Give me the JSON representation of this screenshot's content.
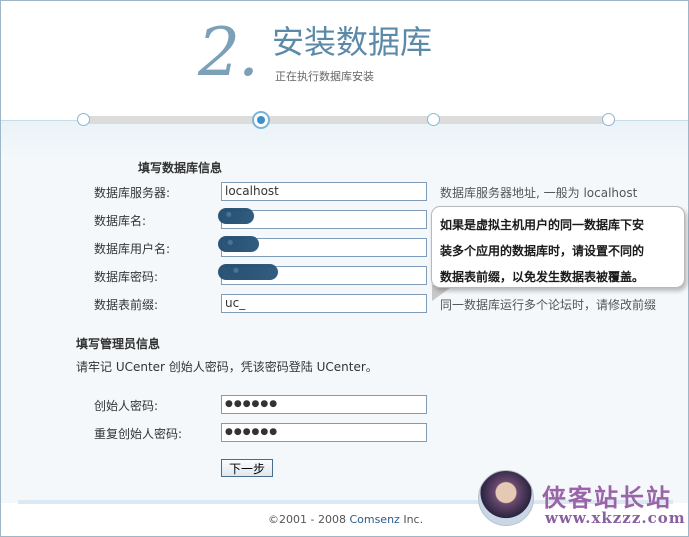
{
  "header": {
    "step_number": "2.",
    "title": "安装数据库",
    "subtitle": "正在执行数据库安装"
  },
  "progress": {
    "total_steps": 4,
    "current_step": 2
  },
  "db_section": {
    "title": "填写数据库信息",
    "fields": [
      {
        "label": "数据库服务器:",
        "value": "localhost",
        "hint": "数据库服务器地址, 一般为 localhost"
      },
      {
        "label": "数据库名:",
        "value": ""
      },
      {
        "label": "数据库用户名:",
        "value": ""
      },
      {
        "label": "数据库密码:",
        "value": ""
      },
      {
        "label": "数据表前缀:",
        "value": "uc_",
        "hint": "同一数据库运行多个论坛时，请修改前缀"
      }
    ]
  },
  "admin_section": {
    "title": "填写管理员信息",
    "note": "请牢记 UCenter 创始人密码，凭该密码登陆 UCenter。",
    "fields": [
      {
        "label": "创始人密码:",
        "value": "●●●●●●"
      },
      {
        "label": "重复创始人密码:",
        "value": "●●●●●●"
      }
    ]
  },
  "buttons": {
    "next": "下一步"
  },
  "tooltip": {
    "lines": [
      "如果是虚拟主机用户的同一数据库下安",
      "装多个应用的数据库时，请设置不同的",
      "数据表前缀，以免发生数据表被覆盖。"
    ]
  },
  "footer": {
    "copyright_prefix": "©2001 - 2008 ",
    "brand": "Comsenz",
    "suffix": " Inc."
  },
  "watermark": {
    "line1": "侠客站长站",
    "line2": "www.xkzzz.com"
  },
  "colors": {
    "accent": "#5b8aa8",
    "active_step": "#3f90c8"
  }
}
